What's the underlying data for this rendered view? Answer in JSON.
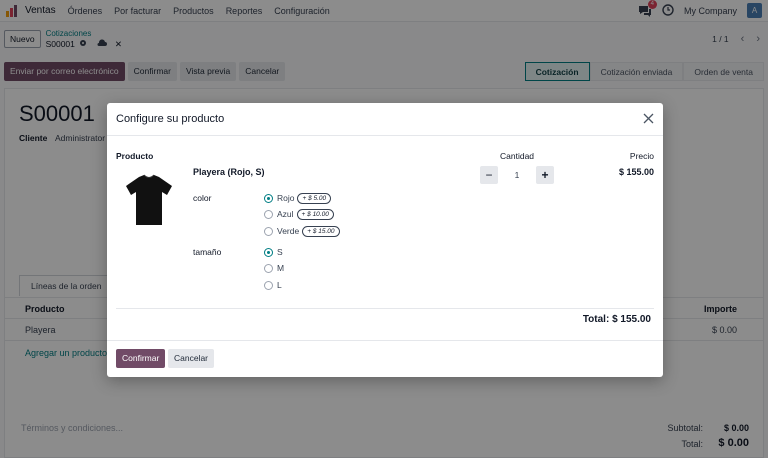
{
  "navbar": {
    "app_name": "Ventas",
    "menu": [
      "Órdenes",
      "Por facturar",
      "Productos",
      "Reportes",
      "Configuración"
    ],
    "chat_badge": "4",
    "company": "My Company",
    "avatar_letter": "A"
  },
  "control": {
    "new_label": "Nuevo",
    "breadcrumb_parent": "Cotizaciones",
    "breadcrumb_current": "S00001",
    "pager": "1 / 1"
  },
  "actions": {
    "send_email": "Enviar por correo electrónico",
    "confirm": "Confirmar",
    "preview": "Vista previa",
    "cancel": "Cancelar"
  },
  "statusbar": [
    "Cotización",
    "Cotización enviada",
    "Orden de venta"
  ],
  "form": {
    "title": "S00001",
    "client_label": "Cliente",
    "client_value": "Administrator",
    "tab_lines": "Líneas de la orden",
    "col_product": "Producto",
    "col_amount": "Importe",
    "line_product": "Playera",
    "line_amount": "$ 0.00",
    "add_product": "Agregar un producto",
    "terms_placeholder": "Términos y condiciones...",
    "subtotal_label": "Subtotal:",
    "subtotal_value": "$ 0.00",
    "total_label": "Total:",
    "total_value": "$ 0.00"
  },
  "modal": {
    "title": "Configure su producto",
    "col_product": "Producto",
    "col_quantity": "Cantidad",
    "col_price": "Precio",
    "product_name": "Playera (Rojo, S)",
    "quantity": "1",
    "price": "$ 155.00",
    "color_label": "color",
    "color_options": [
      {
        "label": "Rojo",
        "extra": "+ $ 5.00",
        "selected": true
      },
      {
        "label": "Azul",
        "extra": "+ $ 10.00",
        "selected": false
      },
      {
        "label": "Verde",
        "extra": "+ $ 15.00",
        "selected": false
      }
    ],
    "size_label": "tamaño",
    "size_options": [
      {
        "label": "S",
        "selected": true
      },
      {
        "label": "M",
        "selected": false
      },
      {
        "label": "L",
        "selected": false
      }
    ],
    "total": "Total: $ 155.00",
    "confirm": "Confirmar",
    "cancel": "Cancelar"
  },
  "colors": {
    "primary": "#714b67",
    "accent": "#017e84"
  }
}
